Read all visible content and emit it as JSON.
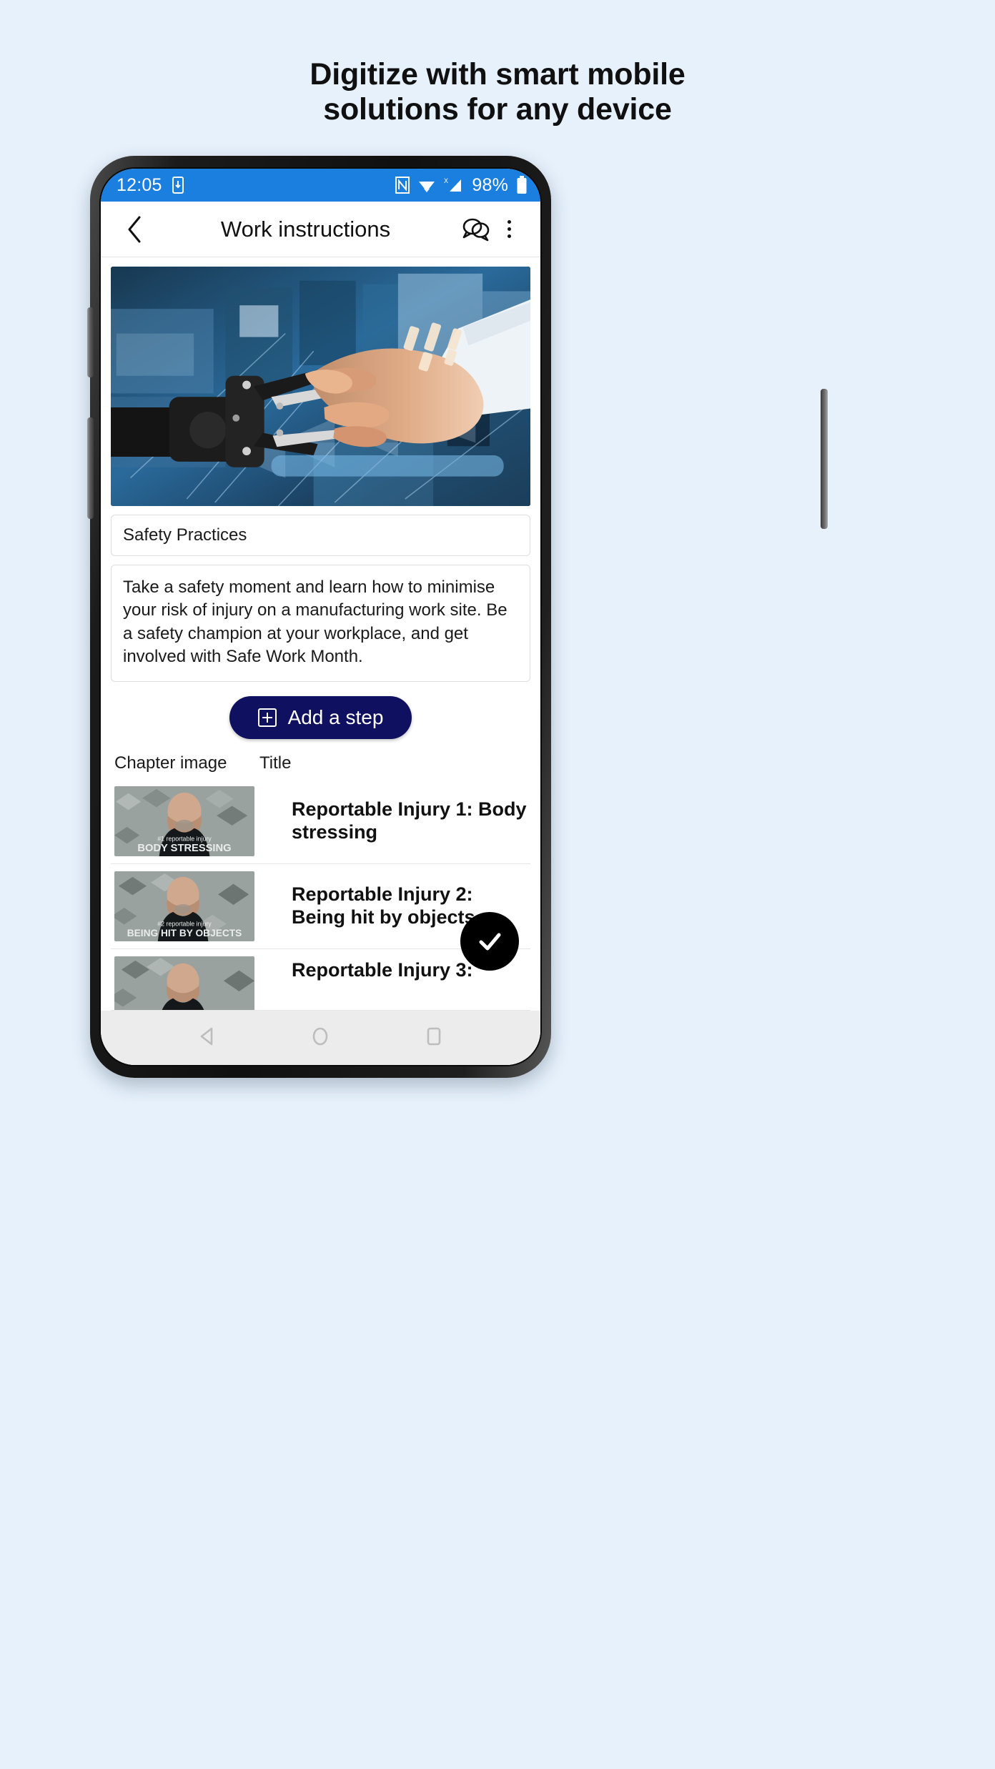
{
  "headline": {
    "line1": "Digitize with smart mobile",
    "line2": "solutions for any device"
  },
  "colors": {
    "page_background": "#e6f1fb",
    "status_bar": "#1b7fe0",
    "primary_button": "#101060",
    "fab": "#000000",
    "nav_bar": "#ececec"
  },
  "status_bar": {
    "time": "12:05",
    "battery_percent": "98%",
    "icons": [
      "sim-card-icon",
      "nfc-icon",
      "wifi-icon",
      "cellular-signal-x-icon",
      "battery-icon"
    ]
  },
  "app_bar": {
    "back_label": "back-chevron",
    "title": "Work instructions",
    "chat_icon": "chat-bubbles-icon",
    "overflow_icon": "more-vertical-icon"
  },
  "hero": {
    "alt": "Robotic hand shaking a human hand in a blue industrial factory setting"
  },
  "form": {
    "title_value": "Safety Practices",
    "description_value": "Take a safety moment and learn how to minimise your risk of injury on a manufacturing work site. Be a safety champion at your workplace, and get involved with Safe Work Month."
  },
  "add_step": {
    "label": "Add a step",
    "icon": "plus-box-icon"
  },
  "table": {
    "headers": {
      "image": "Chapter image",
      "title": "Title"
    },
    "rows": [
      {
        "title": "Reportable Injury 1: Body stressing",
        "thumb_caption_small": "#1 reportable injury",
        "thumb_caption_large": "BODY STRESSING"
      },
      {
        "title": "Reportable Injury 2: Being hit by objects",
        "thumb_caption_small": "#2 reportable injury",
        "thumb_caption_large": "BEING HIT BY OBJECTS"
      },
      {
        "title": "Reportable Injury 3:",
        "thumb_caption_small": "",
        "thumb_caption_large": ""
      }
    ]
  },
  "fab": {
    "icon": "check-icon"
  },
  "nav_bar": {
    "back": "triangle-back-icon",
    "home": "circle-home-icon",
    "recents": "square-recents-icon"
  }
}
